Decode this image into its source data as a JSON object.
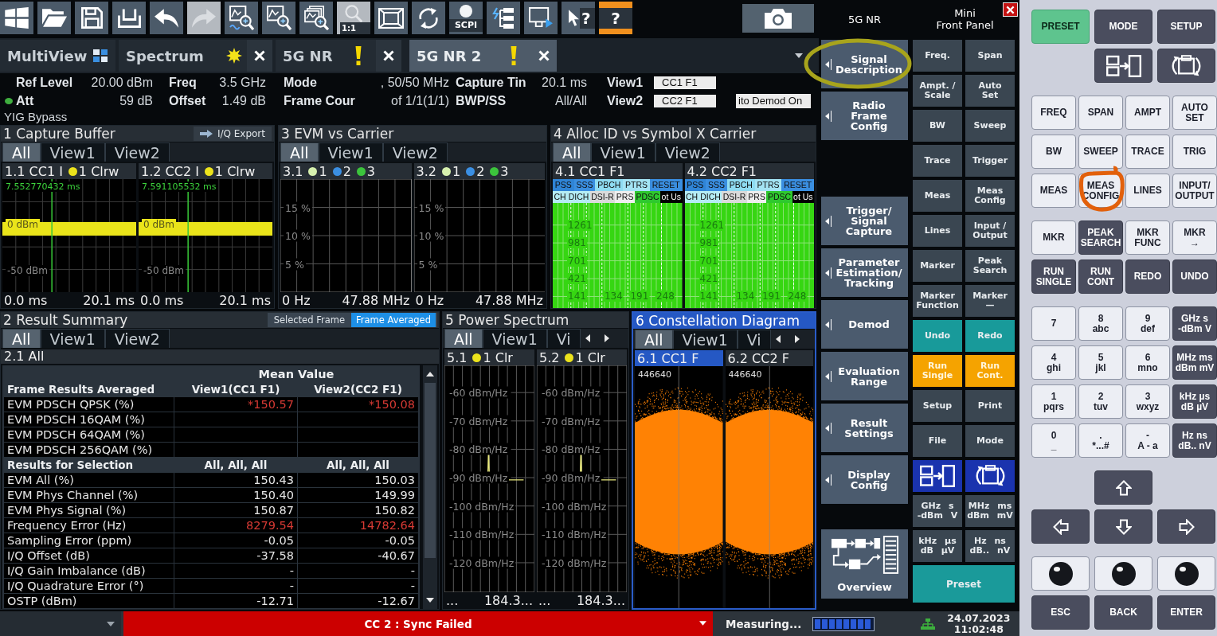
{
  "toolbar": [
    {
      "kind": "start",
      "disabled": false
    },
    {
      "kind": "open",
      "disabled": false
    },
    {
      "kind": "save",
      "disabled": false
    },
    {
      "kind": "print",
      "disabled": false
    },
    {
      "kind": "undo",
      "disabled": false
    },
    {
      "kind": "redo",
      "disabled": true
    },
    {
      "kind": "zoom-trace",
      "disabled": false
    },
    {
      "kind": "zoom",
      "disabled": false
    },
    {
      "kind": "zoom-multi",
      "disabled": false
    },
    {
      "kind": "zoom-reset",
      "label": "1:1",
      "disabled": true
    },
    {
      "kind": "fullscreen",
      "disabled": false
    },
    {
      "kind": "refresh",
      "disabled": false
    },
    {
      "kind": "scpi",
      "label": "SCPI",
      "disabled": false
    },
    {
      "kind": "network",
      "disabled": false
    },
    {
      "kind": "display",
      "disabled": false
    },
    {
      "kind": "pointer-help",
      "label": "?",
      "disabled": false
    },
    {
      "kind": "help",
      "label": "?",
      "disabled": false
    },
    {
      "kind": "camera",
      "disabled": false
    }
  ],
  "tabs": [
    {
      "label": "MultiView",
      "kind": "multiview",
      "closable": false,
      "selected": false
    },
    {
      "label": "Spectrum",
      "kind": "modified",
      "closable": true,
      "selected": false
    },
    {
      "label": "5G NR",
      "kind": "warning",
      "closable": true,
      "selected": false
    },
    {
      "label": "5G NR 2",
      "kind": "warning",
      "closable": true,
      "selected": true
    }
  ],
  "info": {
    "groups": [
      [
        {
          "label": "Ref Level",
          "value": "20.00 dBm",
          "kind": "value",
          "led": false
        },
        {
          "label": "Att",
          "value": "59 dB",
          "kind": "value",
          "led": true
        }
      ],
      [
        {
          "label": "Freq",
          "value": "3.5 GHz",
          "kind": "value",
          "led": false
        },
        {
          "label": "Offset",
          "value": "1.49 dB",
          "kind": "value",
          "led": false
        }
      ],
      [
        {
          "label": "Mode",
          "value": ", 50/50 MHz",
          "kind": "value",
          "led": false
        },
        {
          "label": "Frame Cour",
          "value": "of 1/1(1/1)",
          "kind": "value",
          "led": false
        }
      ],
      [
        {
          "label": "Capture Tin",
          "value": "20.1 ms",
          "kind": "value",
          "led": false
        },
        {
          "label": "BWP/SS",
          "value": "All/All",
          "kind": "value",
          "led": false
        }
      ],
      [
        {
          "label": "View1",
          "value": "CC1 F1",
          "kind": "field",
          "led": false
        },
        {
          "label": "View2",
          "value": "CC2 F1",
          "kind": "field",
          "led": false
        }
      ]
    ],
    "badge": "ito Demod On",
    "note": "YIG Bypass"
  },
  "window_rows": [
    [
      {
        "kind": "capture",
        "title": "1 Capture Buffer",
        "selected": false,
        "export": "I/Q Export",
        "tabs": [
          {
            "label": "All",
            "selected": true
          },
          {
            "label": "View1",
            "selected": false
          },
          {
            "label": "View2",
            "selected": false
          }
        ],
        "subwindows": [
          {
            "title": "1.1 CC1 I",
            "selected": false,
            "traces": [
              {
                "label": "1 Clrw",
                "color": "#ece31c"
              }
            ],
            "marker": "7.552770432 ms",
            "y_labels": [
              "0 dBm",
              "-50 dBm"
            ],
            "x_labels": [
              "0.0 ms",
              "20.1 ms"
            ]
          },
          {
            "title": "1.2 CC2 I",
            "selected": false,
            "traces": [
              {
                "label": "1 Clrw",
                "color": "#ece31c"
              }
            ],
            "marker": "7.591105532 ms",
            "y_labels": [
              "0 dBm",
              "-50 dBm"
            ],
            "x_labels": [
              "0.0 ms",
              "20.1 ms"
            ]
          }
        ]
      },
      {
        "kind": "evm",
        "title": "3 EVM vs Carrier",
        "selected": false,
        "tabs": [
          {
            "label": "All",
            "selected": true
          },
          {
            "label": "View1",
            "selected": false
          },
          {
            "label": "View2",
            "selected": false
          }
        ],
        "subwindows": [
          {
            "title": "3.1",
            "selected": false,
            "traces": [
              {
                "label": "1",
                "color": "#d6f0ae"
              },
              {
                "label": "2",
                "color": "#3b8fe2"
              },
              {
                "label": "3",
                "color": "#3cc43c"
              }
            ],
            "y_labels": [
              "15 %",
              "10 %",
              "5 %"
            ],
            "x_labels": [
              "0 Hz",
              "47.88 MHz"
            ]
          },
          {
            "title": "3.2",
            "selected": false,
            "traces": [
              {
                "label": "1",
                "color": "#d6f0ae"
              },
              {
                "label": "2",
                "color": "#3b8fe2"
              },
              {
                "label": "3",
                "color": "#3cc43c"
              }
            ],
            "y_labels": [
              "15 %",
              "10 %",
              "5 %"
            ],
            "x_labels": [
              "0 Hz",
              "47.88 MHz"
            ]
          }
        ]
      },
      {
        "kind": "alloc",
        "title": "4 Alloc ID vs Symbol X Carrier",
        "selected": false,
        "tabs": [
          {
            "label": "All",
            "selected": true
          },
          {
            "label": "View1",
            "selected": false
          },
          {
            "label": "View2",
            "selected": false
          }
        ],
        "subwindows": [
          {
            "title": "4.1 CC1 F1",
            "selected": false,
            "legend": [
              [
                {
                  "label": "PSS",
                  "color": "#2f84d6"
                },
                {
                  "label": "SSS",
                  "color": "#3a8ee0"
                },
                {
                  "label": "PBCH",
                  "color": "#8fdcf2"
                },
                {
                  "label": "PTRS",
                  "color": "#a4e4f4"
                },
                {
                  "label": "RESET",
                  "color": "#3a8ee0"
                }
              ],
              [
                {
                  "label": "CH",
                  "color": "#b4ecf4"
                },
                {
                  "label": "DICH",
                  "color": "#b4ecf4"
                },
                {
                  "label": "DSI-R",
                  "color": "#dadada"
                },
                {
                  "label": "PRS",
                  "color": "#eeeeee"
                },
                {
                  "label": "PDSC",
                  "color": "#2ec82e"
                },
                {
                  "label": "ot Us",
                  "color": "#000000"
                }
              ]
            ],
            "y_labels": [
              "1261",
              "981",
              "701",
              "421",
              "141"
            ],
            "x_labels": [
              "134",
              "191",
              "248"
            ]
          },
          {
            "title": "4.2 CC2 F1",
            "selected": false,
            "legend": [
              [
                {
                  "label": "PSS",
                  "color": "#2f84d6"
                },
                {
                  "label": "SSS",
                  "color": "#3a8ee0"
                },
                {
                  "label": "PBCH",
                  "color": "#8fdcf2"
                },
                {
                  "label": "PTRS",
                  "color": "#a4e4f4"
                },
                {
                  "label": "RESET",
                  "color": "#3a8ee0"
                }
              ],
              [
                {
                  "label": "CH",
                  "color": "#b4ecf4"
                },
                {
                  "label": "DICH",
                  "color": "#b4ecf4"
                },
                {
                  "label": "DSI-R",
                  "color": "#dadada"
                },
                {
                  "label": "PRS",
                  "color": "#eeeeee"
                },
                {
                  "label": "PDSC",
                  "color": "#2ec82e"
                },
                {
                  "label": "ot Us",
                  "color": "#000000"
                }
              ]
            ],
            "y_labels": [
              "1261",
              "981",
              "701",
              "421",
              "141"
            ],
            "x_labels": [
              "134",
              "191",
              "248"
            ]
          }
        ]
      }
    ],
    [
      {
        "kind": "summary",
        "title": "2 Result Summary",
        "selected": false,
        "toggle": [
          {
            "label": "Selected Frame",
            "selected": false
          },
          {
            "label": "Frame Averaged",
            "selected": true
          }
        ],
        "tabs": [
          {
            "label": "All",
            "selected": true
          },
          {
            "label": "View1",
            "selected": false
          },
          {
            "label": "View2",
            "selected": false
          }
        ],
        "subtitle": "2.1 All",
        "table": {
          "group_header": "Mean Value",
          "sections": [
            {
              "header": [
                "Frame Results Averaged",
                "View1(CC1 F1)",
                "View2(CC2 F1)"
              ],
              "rows": [
                {
                  "label": "EVM PDSCH QPSK (%)",
                  "values": [
                    "*150.57",
                    "*150.08"
                  ],
                  "alert": true
                },
                {
                  "label": "EVM PDSCH 16QAM (%)",
                  "values": []
                },
                {
                  "label": "EVM PDSCH 64QAM (%)",
                  "values": []
                },
                {
                  "label": "EVM PDSCH 256QAM (%)",
                  "values": []
                }
              ]
            },
            {
              "header": [
                "Results for Selection",
                "All, All, All",
                "All, All, All"
              ],
              "rows": [
                {
                  "label": "EVM All (%)",
                  "values": [
                    "150.43",
                    "150.03"
                  ],
                  "alert": false
                },
                {
                  "label": "EVM Phys Channel (%)",
                  "values": [
                    "150.40",
                    "149.99"
                  ],
                  "alert": false
                },
                {
                  "label": "EVM Phys Signal (%)",
                  "values": [
                    "150.87",
                    "150.82"
                  ],
                  "alert": false
                },
                {
                  "label": "Frequency Error (Hz)",
                  "values": [
                    "8279.54",
                    "14782.64"
                  ],
                  "alert": true
                },
                {
                  "label": "Sampling Error (ppm)",
                  "values": [
                    "-0.05",
                    "-0.05"
                  ],
                  "alert": false
                },
                {
                  "label": "I/Q Offset (dB)",
                  "values": [
                    "-37.58",
                    "-40.67"
                  ],
                  "alert": false
                },
                {
                  "label": "I/Q Gain Imbalance (dB)",
                  "values": [
                    "-",
                    "-"
                  ],
                  "alert": false
                },
                {
                  "label": "I/Q Quadrature Error (°)",
                  "values": [
                    "-",
                    "-"
                  ],
                  "alert": false
                },
                {
                  "label": "OSTP (dBm)",
                  "values": [
                    "-12.71",
                    "-12.67"
                  ],
                  "alert": false
                }
              ]
            }
          ]
        }
      },
      {
        "kind": "spectrum",
        "title": "5 Power Spectrum",
        "selected": false,
        "scroll_arrows": true,
        "tabs": [
          {
            "label": "All",
            "selected": true
          },
          {
            "label": "View1",
            "selected": false
          },
          {
            "label": "Vi",
            "selected": false
          }
        ],
        "subwindows": [
          {
            "title": "5.1",
            "selected": false,
            "traces": [
              {
                "label": "1 Clr",
                "color": "#ece31c"
              }
            ],
            "y_labels": [
              "-60 dBm/Hz",
              "-70 dBm/Hz",
              "-80 dBm/Hz",
              "-90 dBm/Hz",
              "-100 dBm/Hz",
              "-110 dBm/Hz",
              "-120 dBm/Hz"
            ],
            "x_labels": [
              "...",
              "184.3..."
            ]
          },
          {
            "title": "5.2",
            "selected": false,
            "traces": [
              {
                "label": "1 Clr",
                "color": "#ece31c"
              }
            ],
            "y_labels": [
              "-60 dBm/Hz",
              "-70 dBm/Hz",
              "-80 dBm/Hz",
              "-90 dBm/Hz",
              "-100 dBm/Hz",
              "-110 dBm/Hz",
              "-120 dBm/Hz"
            ],
            "x_labels": [
              "...",
              "184.3..."
            ]
          }
        ]
      },
      {
        "kind": "constellation",
        "title": "6 Constellation Diagram",
        "selected": true,
        "scroll_arrows": true,
        "tabs": [
          {
            "label": "All",
            "selected": true
          },
          {
            "label": "View1",
            "selected": false
          },
          {
            "label": "Vi",
            "selected": false
          }
        ],
        "subwindows": [
          {
            "title": "6.1 CC1 F",
            "selected": true,
            "count": "446640"
          },
          {
            "title": "6.2 CC2 F",
            "selected": false,
            "count": "446640"
          }
        ]
      }
    ]
  ],
  "status_bar": {
    "message": "CC 2 : Sync Failed",
    "kind": "error",
    "activity": "Measuring...",
    "progress": {
      "level": 1
    },
    "date": "24.07.2023",
    "time": "11:02:48"
  },
  "softkeys": {
    "title": "5G NR",
    "items": [
      {
        "label": "Signal\nDescription",
        "kind": "submenu",
        "highlighted": true
      },
      {
        "label": "Radio\nFrame\nConfig",
        "kind": "submenu",
        "highlighted": false
      },
      {
        "label": "Trigger/\nSignal\nCapture",
        "kind": "submenu",
        "highlighted": false
      },
      {
        "label": "Parameter\nEstimation/\nTracking",
        "kind": "submenu",
        "highlighted": false
      },
      {
        "label": "Demod",
        "kind": "submenu",
        "highlighted": false
      },
      {
        "label": "Evaluation\nRange",
        "kind": "submenu",
        "highlighted": false
      },
      {
        "label": "Result\nSettings",
        "kind": "submenu",
        "highlighted": false
      },
      {
        "label": "Display\nConfig",
        "kind": "submenu",
        "highlighted": false
      },
      {
        "label": "Overview",
        "kind": "overview",
        "highlighted": false
      }
    ]
  },
  "mini_panel": {
    "title": "Mini\nFront Panel",
    "keys": [
      {
        "label": "Freq.",
        "kind": "key"
      },
      {
        "label": "Span",
        "kind": "key"
      },
      {
        "label": "Ampt. /\nScale",
        "kind": "key"
      },
      {
        "label": "Auto\nSet",
        "kind": "key"
      },
      {
        "label": "BW",
        "kind": "key"
      },
      {
        "label": "Sweep",
        "kind": "key"
      },
      {
        "label": "Trace",
        "kind": "key"
      },
      {
        "label": "Trigger",
        "kind": "key"
      },
      {
        "label": "Meas",
        "kind": "key"
      },
      {
        "label": "Meas\nConfig",
        "kind": "key"
      },
      {
        "label": "Lines",
        "kind": "key"
      },
      {
        "label": "Input /\nOutput",
        "kind": "key"
      },
      {
        "label": "Marker",
        "kind": "key"
      },
      {
        "label": "Peak\nSearch",
        "kind": "key"
      },
      {
        "label": "Marker\nFunction",
        "kind": "key"
      },
      {
        "label": "Marker\n—",
        "kind": "key"
      },
      {
        "label": "Undo",
        "kind": "edit"
      },
      {
        "label": "Redo",
        "kind": "edit"
      },
      {
        "label": "Run\nSingle",
        "kind": "run"
      },
      {
        "label": "Run\nCont.",
        "kind": "run"
      },
      {
        "label": "Setup",
        "kind": "key"
      },
      {
        "label": "Print",
        "kind": "key"
      },
      {
        "label": "File",
        "kind": "key"
      },
      {
        "label": "Mode",
        "kind": "key"
      },
      {
        "kind": "display-split"
      },
      {
        "kind": "display-swap"
      },
      {
        "label": "GHz s\n-dBm V",
        "kind": "units"
      },
      {
        "label": "MHz ms\ndBm mV",
        "kind": "units"
      },
      {
        "label": "kHz µs\ndB µV",
        "kind": "units"
      },
      {
        "label": "Hz ns\ndB.. nV",
        "kind": "units"
      },
      {
        "label": "Preset",
        "kind": "preset"
      }
    ]
  },
  "hardware_panel": {
    "groups": [
      [
        {
          "kind": "left",
          "keys": [
            {
              "label": "PRESET",
              "kind": "preset",
              "highlighted": false
            },
            {
              "label": "MODE",
              "kind": "dark",
              "highlighted": false
            },
            {
              "label": "SETUP",
              "kind": "dark",
              "highlighted": false
            }
          ]
        },
        {
          "kind": "right",
          "keys": [
            {
              "kind": "display-split",
              "highlighted": false
            },
            {
              "kind": "display-swap",
              "highlighted": false
            }
          ]
        }
      ],
      [
        {
          "kind": "left",
          "keys": [
            {
              "label": "FREQ",
              "kind": "light",
              "highlighted": false
            },
            {
              "label": "SPAN",
              "kind": "light",
              "highlighted": false
            },
            {
              "label": "AMPT",
              "kind": "light",
              "highlighted": false
            },
            {
              "label": "AUTO\nSET",
              "kind": "light",
              "highlighted": false
            }
          ]
        },
        {
          "kind": "left",
          "keys": [
            {
              "label": "BW",
              "kind": "light",
              "highlighted": false
            },
            {
              "label": "SWEEP",
              "kind": "light",
              "highlighted": false
            },
            {
              "label": "TRACE",
              "kind": "light",
              "highlighted": false
            },
            {
              "label": "TRIG",
              "kind": "light",
              "highlighted": false
            }
          ]
        },
        {
          "kind": "left",
          "keys": [
            {
              "label": "MEAS",
              "kind": "light",
              "highlighted": false
            },
            {
              "label": "MEAS\nCONFIG",
              "kind": "light",
              "highlighted": true
            },
            {
              "label": "LINES",
              "kind": "light",
              "highlighted": false
            },
            {
              "label": "INPUT/\nOUTPUT",
              "kind": "light",
              "highlighted": false
            }
          ]
        }
      ],
      [
        {
          "kind": "left",
          "keys": [
            {
              "label": "MKR",
              "kind": "light",
              "highlighted": false
            },
            {
              "label": "PEAK\nSEARCH",
              "kind": "dark",
              "highlighted": false
            },
            {
              "label": "MKR\nFUNC",
              "kind": "light",
              "highlighted": false
            },
            {
              "label": "MKR\n→",
              "kind": "light",
              "highlighted": false
            }
          ]
        },
        {
          "kind": "left",
          "keys": [
            {
              "label": "RUN\nSINGLE",
              "kind": "dark",
              "highlighted": false
            },
            {
              "label": "RUN\nCONT",
              "kind": "dark",
              "highlighted": false
            },
            {
              "label": "REDO",
              "kind": "dark",
              "highlighted": false
            },
            {
              "label": "UNDO",
              "kind": "dark",
              "highlighted": false
            }
          ]
        }
      ],
      [
        {
          "kind": "left",
          "keys": [
            {
              "label": "7",
              "kind": "light",
              "highlighted": false
            },
            {
              "label": "8\nabc",
              "kind": "light",
              "highlighted": false
            },
            {
              "label": "9\ndef",
              "kind": "light",
              "highlighted": false
            },
            {
              "label": "GHz s\n-dBm V",
              "kind": "dark",
              "highlighted": false
            }
          ]
        },
        {
          "kind": "left",
          "keys": [
            {
              "label": "4\nghi",
              "kind": "light",
              "highlighted": false
            },
            {
              "label": "5\njkl",
              "kind": "light",
              "highlighted": false
            },
            {
              "label": "6\nmno",
              "kind": "light",
              "highlighted": false
            },
            {
              "label": "MHz ms\ndBm mV",
              "kind": "dark",
              "highlighted": false
            }
          ]
        },
        {
          "kind": "left",
          "keys": [
            {
              "label": "1\npqrs",
              "kind": "light",
              "highlighted": false
            },
            {
              "label": "2\ntuv",
              "kind": "light",
              "highlighted": false
            },
            {
              "label": "3\nwxyz",
              "kind": "light",
              "highlighted": false
            },
            {
              "label": "kHz µs\ndB µV",
              "kind": "dark",
              "highlighted": false
            }
          ]
        },
        {
          "kind": "left",
          "keys": [
            {
              "label": "0\n_",
              "kind": "light",
              "highlighted": false
            },
            {
              "label": ".\n*...#",
              "kind": "light",
              "highlighted": false
            },
            {
              "label": "-\nA - a",
              "kind": "light",
              "highlighted": false
            },
            {
              "label": "Hz ns\ndB.. nV",
              "kind": "dark",
              "highlighted": false
            }
          ]
        }
      ],
      [
        {
          "kind": "center",
          "keys": [
            {
              "kind": "arrow-up",
              "highlighted": false
            }
          ]
        },
        {
          "kind": "left",
          "keys": [
            {
              "kind": "arrow-left",
              "highlighted": false
            },
            {
              "kind": "arrow-down",
              "highlighted": false
            },
            {
              "kind": "arrow-right",
              "highlighted": false
            }
          ]
        }
      ],
      [
        {
          "kind": "left",
          "keys": [
            {
              "kind": "knob",
              "highlighted": false
            },
            {
              "kind": "knob",
              "highlighted": false
            },
            {
              "kind": "knob",
              "highlighted": false
            }
          ]
        },
        {
          "kind": "left",
          "keys": [
            {
              "label": "ESC",
              "kind": "dark",
              "highlighted": false
            },
            {
              "label": "BACK",
              "kind": "dark",
              "highlighted": false
            },
            {
              "label": "ENTER",
              "kind": "dark",
              "highlighted": false
            }
          ]
        }
      ]
    ]
  }
}
